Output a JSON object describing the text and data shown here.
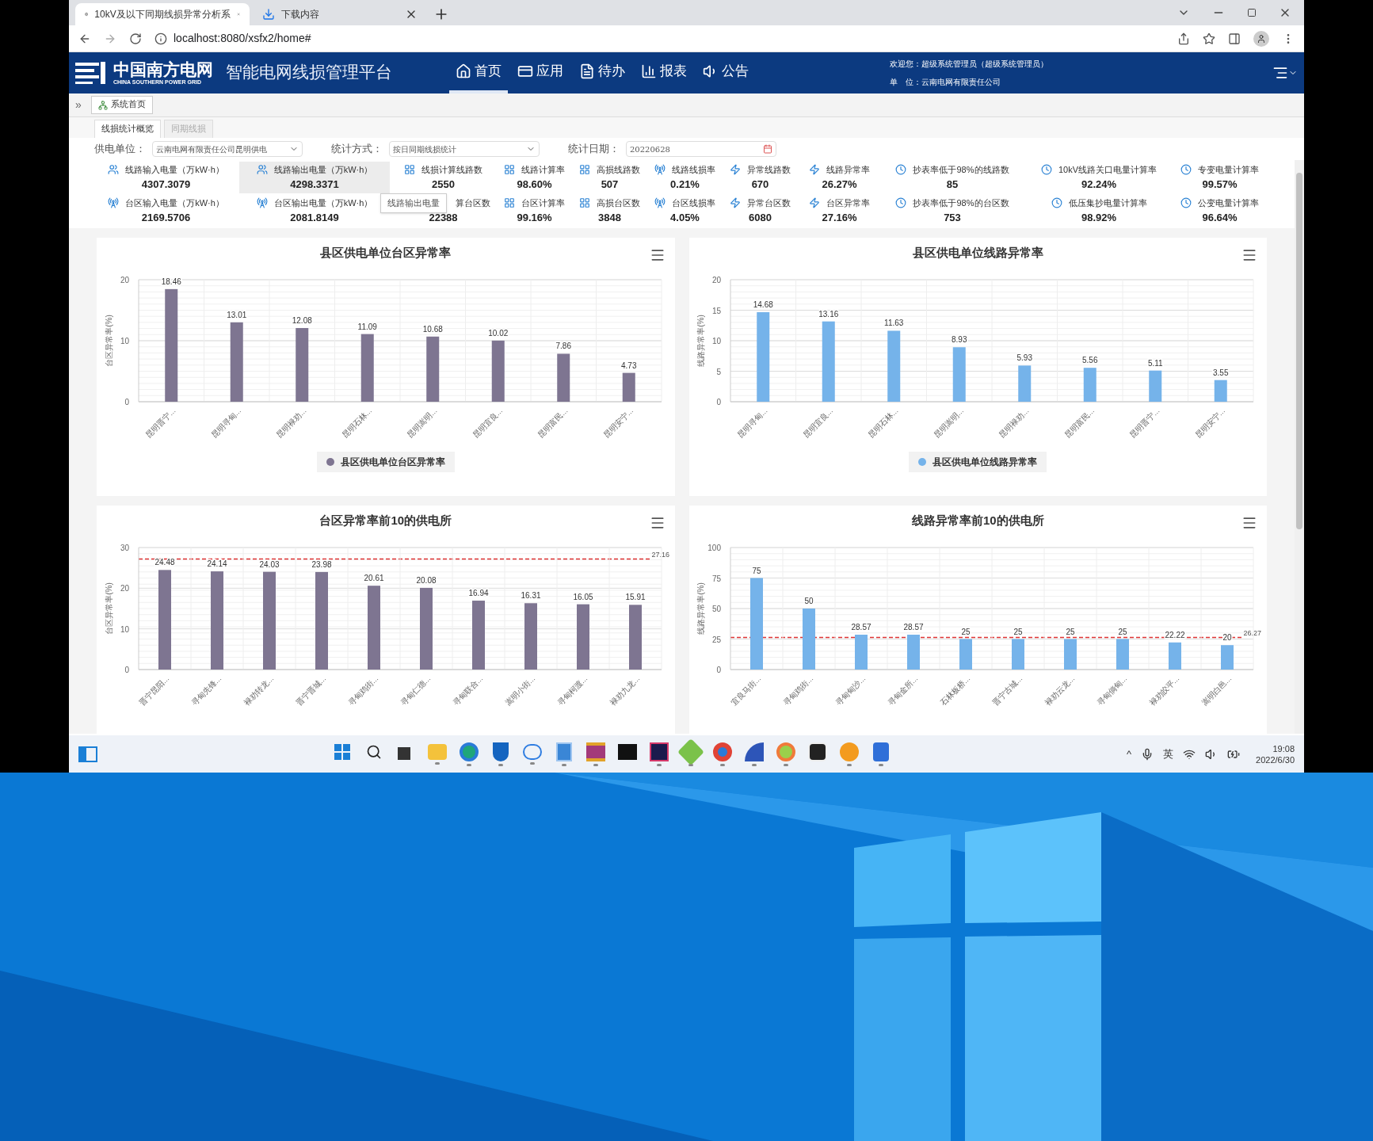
{
  "browser": {
    "tabs": [
      {
        "title": "10kV及以下同期线损异常分析系",
        "selected": true,
        "kind": "page"
      },
      {
        "title": "下载内容",
        "selected": false,
        "kind": "download"
      }
    ],
    "address": "localhost:8080/xsfx2/home#"
  },
  "header": {
    "logo_cn": "中国南方电网",
    "logo_en": "CHINA SOUTHERN POWER GRID",
    "platform": "智能电网线损管理平台",
    "nav": [
      {
        "label": "首页",
        "kind": "home",
        "selected": true
      },
      {
        "label": "应用",
        "kind": "app",
        "selected": false
      },
      {
        "label": "待办",
        "kind": "todo",
        "selected": false
      },
      {
        "label": "报表",
        "kind": "report",
        "selected": false
      },
      {
        "label": "公告",
        "kind": "notice",
        "selected": false
      }
    ],
    "welcome": "欢迎您：超级系统管理员（超级系统管理员）",
    "unit": "单　位：云南电网有限责任公司"
  },
  "breadcrumb": {
    "expand": "»",
    "tab": "系统首页"
  },
  "subtabs": [
    {
      "label": "线损统计概览",
      "selected": true
    },
    {
      "label": "同期线损",
      "selected": false
    }
  ],
  "filters": [
    {
      "label": "供电单位：",
      "value": "云南电网有限责任公司昆明供电",
      "kind": "select"
    },
    {
      "label": "统计方式：",
      "value": "按日同期线损统计",
      "kind": "select"
    },
    {
      "label": "统计日期：",
      "value": "20220628",
      "kind": "date"
    }
  ],
  "stats": [
    [
      {
        "label": "线路输入电量（万kW·h）",
        "value": "4307.3079",
        "kind": "line_energy",
        "hovered": false
      },
      {
        "label": "线路输出电量（万kW·h）",
        "value": "4298.3371",
        "kind": "line_energy",
        "hovered": true
      },
      {
        "label": "线损计算线路数",
        "value": "2550",
        "kind": "count",
        "hovered": false
      },
      {
        "label": "线路计算率",
        "value": "98.60%",
        "kind": "count",
        "hovered": false
      },
      {
        "label": "高损线路数",
        "value": "507",
        "kind": "count",
        "hovered": false
      },
      {
        "label": "线路线损率",
        "value": "0.21%",
        "kind": "area_energy",
        "hovered": false
      },
      {
        "label": "异常线路数",
        "value": "670",
        "kind": "anomaly",
        "hovered": false
      },
      {
        "label": "线路异常率",
        "value": "26.27%",
        "kind": "anomaly",
        "hovered": false
      },
      {
        "label": "抄表率低于98%的线路数",
        "value": "85",
        "kind": "meter",
        "hovered": false
      },
      {
        "label": "10kV线路关口电量计算率",
        "value": "92.24%",
        "kind": "meter",
        "hovered": false
      },
      {
        "label": "专变电量计算率",
        "value": "99.57%",
        "kind": "meter",
        "hovered": false
      }
    ],
    [
      {
        "label": "台区输入电量（万kW·h）",
        "value": "2169.5706",
        "kind": "area_energy",
        "hovered": false
      },
      {
        "label": "台区输出电量（万kW·h）",
        "value": "2081.8149",
        "kind": "area_energy",
        "hovered": false
      },
      {
        "label": "算台区数",
        "value": "22388",
        "kind": "covered",
        "hovered": false
      },
      {
        "label": "台区计算率",
        "value": "99.16%",
        "kind": "count",
        "hovered": false
      },
      {
        "label": "高损台区数",
        "value": "3848",
        "kind": "count",
        "hovered": false
      },
      {
        "label": "台区线损率",
        "value": "4.05%",
        "kind": "area_energy",
        "hovered": false
      },
      {
        "label": "异常台区数",
        "value": "6080",
        "kind": "anomaly",
        "hovered": false
      },
      {
        "label": "台区异常率",
        "value": "27.16%",
        "kind": "anomaly",
        "hovered": false
      },
      {
        "label": "抄表率低于98%的台区数",
        "value": "753",
        "kind": "meter",
        "hovered": false
      },
      {
        "label": "低压集抄电量计算率",
        "value": "98.92%",
        "kind": "meter",
        "hovered": false
      },
      {
        "label": "公变电量计算率",
        "value": "96.64%",
        "kind": "meter",
        "hovered": false
      }
    ]
  ],
  "tooltip": "线路输出电量",
  "charts": [
    {
      "chart_data": {
        "type": "bar",
        "title": "县区供电单位台区异常率",
        "ylabel": "台区异常率(%)",
        "categories": [
          "昆明晋宁...",
          "昆明寻甸...",
          "昆明禄劝...",
          "昆明石林...",
          "昆明嵩明...",
          "昆明宜良...",
          "昆明富民...",
          "昆明安宁..."
        ],
        "ylim": [
          0,
          20
        ],
        "yticks": [
          0,
          10,
          20
        ],
        "data_labels": true,
        "grid": true,
        "series": [
          {
            "name": "县区供电单位台区异常率",
            "color": "#7e7591",
            "values": [
              18.46,
              13.01,
              12.08,
              11.09,
              10.68,
              10.02,
              7.86,
              4.73
            ]
          }
        ]
      }
    },
    {
      "chart_data": {
        "type": "bar",
        "title": "县区供电单位线路异常率",
        "ylabel": "线路异常率(%)",
        "categories": [
          "昆明寻甸...",
          "昆明宜良...",
          "昆明石林...",
          "昆明嵩明...",
          "昆明禄劝...",
          "昆明富民...",
          "昆明晋宁...",
          "昆明安宁..."
        ],
        "ylim": [
          0,
          20
        ],
        "yticks": [
          0,
          5,
          10,
          15,
          20
        ],
        "data_labels": true,
        "grid": true,
        "series": [
          {
            "name": "县区供电单位线路异常率",
            "color": "#75b3ea",
            "values": [
              14.68,
              13.16,
              11.63,
              8.93,
              5.93,
              5.56,
              5.11,
              3.55
            ]
          }
        ]
      }
    },
    {
      "chart_data": {
        "type": "bar",
        "title": "台区异常率前10的供电所",
        "ylabel": "台区异常率(%)",
        "categories": [
          "晋宁昆阳...",
          "寻甸先锋...",
          "禄劝转龙...",
          "晋宁晋城...",
          "寻甸鸡街...",
          "寻甸仁德...",
          "寻甸联合...",
          "嵩明小街...",
          "寻甸柯渡...",
          "禄劝九龙..."
        ],
        "ylim": [
          0,
          30
        ],
        "yticks": [
          0,
          10,
          20,
          30
        ],
        "data_labels": true,
        "series": [
          {
            "color": "#7e7591",
            "values": [
              24.48,
              24.14,
              24.03,
              23.98,
              20.61,
              20.08,
              16.94,
              16.31,
              16.05,
              15.91
            ]
          }
        ],
        "ref_lines": [
          {
            "axis": "y",
            "value": 27.16,
            "label": "27.16"
          }
        ],
        "grid": true
      }
    },
    {
      "chart_data": {
        "type": "bar",
        "title": "线路异常率前10的供电所",
        "ylabel": "线路异常率(%)",
        "categories": [
          "宜良马街...",
          "寻甸鸡街...",
          "寻甸甸沙...",
          "寻甸金所...",
          "石林板桥...",
          "晋宁古城...",
          "禄劝云龙...",
          "寻甸倘甸...",
          "禄劝皎平...",
          "嵩明白邑..."
        ],
        "ylim": [
          0,
          100
        ],
        "yticks": [
          0,
          25,
          50,
          75,
          100
        ],
        "data_labels": true,
        "series": [
          {
            "color": "#75b3ea",
            "values": [
              75,
              50,
              28.57,
              28.57,
              25,
              25,
              25,
              25,
              22.22,
              20
            ]
          }
        ],
        "ref_lines": [
          {
            "axis": "y",
            "value": 26.27,
            "label": "26.27"
          }
        ],
        "grid": true
      }
    }
  ],
  "taskbar": {
    "apps": [
      {
        "kind": "start",
        "active": false
      },
      {
        "kind": "search",
        "active": false
      },
      {
        "kind": "taskview",
        "active": false
      },
      {
        "kind": "folder",
        "active": true
      },
      {
        "kind": "edge",
        "active": true
      },
      {
        "kind": "shield",
        "active": true
      },
      {
        "kind": "chat",
        "active": true
      },
      {
        "kind": "notes",
        "active": true
      },
      {
        "kind": "archive",
        "active": true
      },
      {
        "kind": "terminal",
        "active": false
      },
      {
        "kind": "ide",
        "active": true
      },
      {
        "kind": "tool",
        "active": true
      },
      {
        "kind": "chrome",
        "active": true
      },
      {
        "kind": "paint",
        "active": true
      },
      {
        "kind": "flower",
        "active": true
      },
      {
        "kind": "camera",
        "active": false
      },
      {
        "kind": "magnifier",
        "active": true
      },
      {
        "kind": "writer",
        "active": true
      }
    ],
    "chevron": "^",
    "ime": "英",
    "time": "19:08",
    "date": "2022/6/30"
  }
}
